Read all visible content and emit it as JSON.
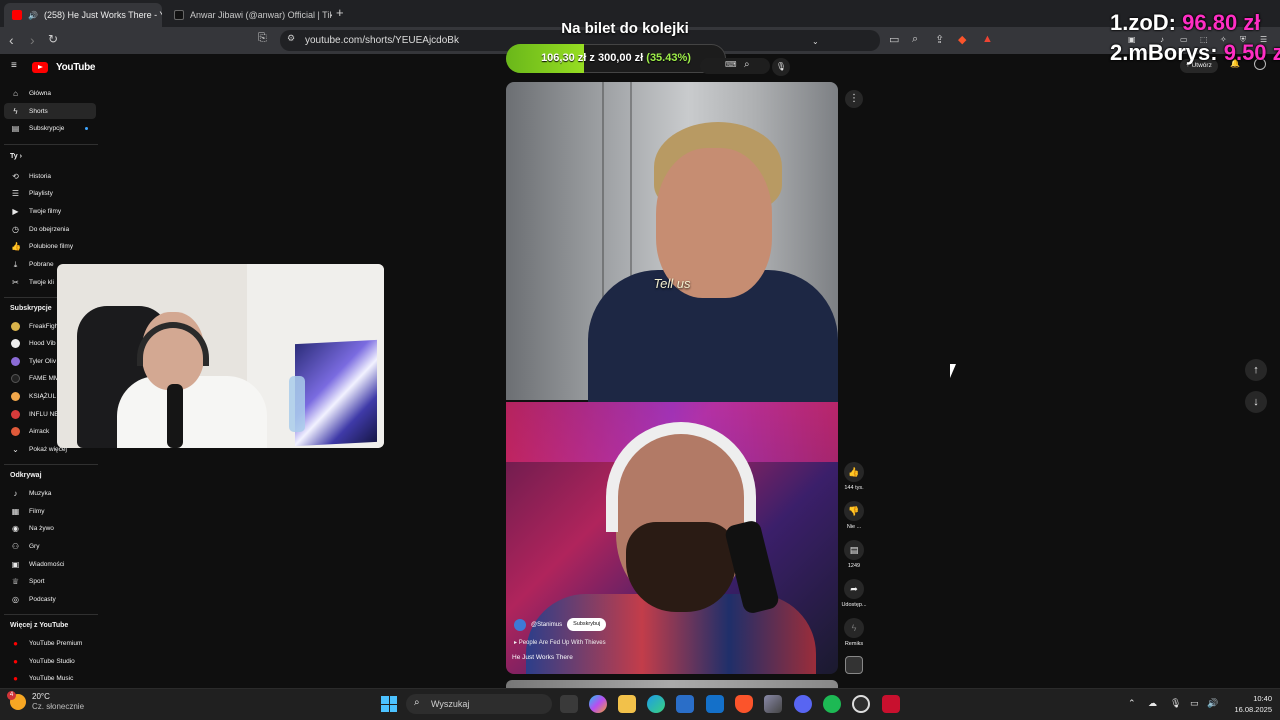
{
  "browser": {
    "tabs": [
      {
        "title": "(258) He Just Works There - Y",
        "favicon_color": "#ff0000",
        "active": true
      },
      {
        "title": "Anwar Jibawi (@anwar) Official | TikT",
        "favicon_color": "#111111",
        "active": false
      }
    ],
    "new_tab": "+",
    "url": "youtube.com/shorts/YEUEAjcdoBk"
  },
  "youtube": {
    "logo_text": "YouTube",
    "create_label": "Utwórz",
    "nav_main": [
      {
        "label": "Główna",
        "icon": "home-icon"
      },
      {
        "label": "Shorts",
        "icon": "shorts-icon",
        "active": true
      },
      {
        "label": "Subskrypcje",
        "icon": "subscriptions-icon"
      }
    ],
    "you_section": {
      "title": "Ty",
      "items": [
        {
          "label": "Historia",
          "icon": "history-icon"
        },
        {
          "label": "Playlisty",
          "icon": "playlist-icon"
        },
        {
          "label": "Twoje filmy",
          "icon": "your-videos-icon"
        },
        {
          "label": "Do obejrzenia",
          "icon": "watch-later-icon"
        },
        {
          "label": "Polubione filmy",
          "icon": "like-icon"
        },
        {
          "label": "Pobrane",
          "icon": "download-icon"
        },
        {
          "label": "Twoje kli",
          "icon": "clips-icon"
        }
      ]
    },
    "subs_section": {
      "title": "Subskrypcje",
      "items": [
        {
          "label": "FreakFigh",
          "color": "#d8b24a"
        },
        {
          "label": "Hood Vib",
          "color": "#eeeeee"
        },
        {
          "label": "Tyler Oliv",
          "color": "#8b6bd6"
        },
        {
          "label": "FAME MM",
          "color": "#222222"
        },
        {
          "label": "KSIĄŻUL",
          "color": "#f0a64a"
        },
        {
          "label": "INFLU NE",
          "color": "#d83b3b"
        },
        {
          "label": "Airrack",
          "color": "#e05a3a"
        },
        {
          "label": "Pokaż więcej",
          "color": ""
        }
      ]
    },
    "explore_section": {
      "title": "Odkrywaj",
      "items": [
        {
          "label": "Muzyka",
          "icon": "music-icon"
        },
        {
          "label": "Filmy",
          "icon": "movies-icon"
        },
        {
          "label": "Na żywo",
          "icon": "live-icon"
        },
        {
          "label": "Gry",
          "icon": "gaming-icon"
        },
        {
          "label": "Wiadomości",
          "icon": "news-icon"
        },
        {
          "label": "Sport",
          "icon": "sport-icon"
        },
        {
          "label": "Podcasty",
          "icon": "podcast-icon"
        }
      ]
    },
    "more_section": {
      "title": "Więcej z YouTube",
      "items": [
        {
          "label": "YouTube Premium"
        },
        {
          "label": "YouTube Studio"
        },
        {
          "label": "YouTube Music"
        }
      ]
    }
  },
  "stream_overlay": {
    "goal_title": "Na bilet do kolejki",
    "goal_current": "106,30 zł",
    "goal_sep": "z",
    "goal_target": "300,00 zł",
    "goal_percent_text": "(35.43%)",
    "goal_fraction": 0.3543,
    "leaderboard": [
      {
        "rank_name": "1.zoD:",
        "amount": "96.80 zł"
      },
      {
        "rank_name": "2.mBorys:",
        "amount": "9.50 zł"
      }
    ]
  },
  "short": {
    "subtitle": "Tell us",
    "channel": "@Stanimus",
    "subscribe_label": "Subskrybuj",
    "music_line": "People Are Fed Up With Thieves",
    "title": "He Just Works There",
    "actions": [
      {
        "name": "like",
        "icon": "thumbs-up-icon",
        "label": "144 tys."
      },
      {
        "name": "dislike",
        "icon": "thumbs-down-icon",
        "label": "Nie ..."
      },
      {
        "name": "comments",
        "icon": "comment-icon",
        "label": "1249"
      },
      {
        "name": "share",
        "icon": "share-icon",
        "label": "Udostęp..."
      },
      {
        "name": "remix",
        "icon": "remix-icon",
        "label": "Remiks"
      }
    ]
  },
  "taskbar": {
    "weather_temp": "20°C",
    "weather_desc": "Cz. słonecznie",
    "weather_badge": "4",
    "search_placeholder": "Wyszukaj",
    "time": "10:40",
    "date": "16.08.2025"
  }
}
